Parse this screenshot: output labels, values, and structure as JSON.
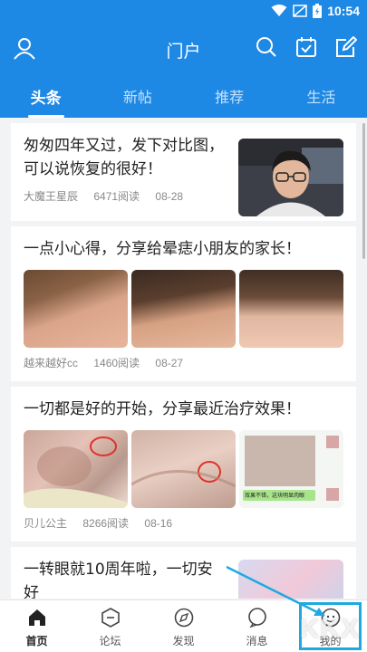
{
  "status": {
    "time": "10:54"
  },
  "appbar": {
    "title": "门户"
  },
  "tabs": [
    {
      "label": "头条",
      "active": true
    },
    {
      "label": "新帖",
      "active": false
    },
    {
      "label": "推荐",
      "active": false
    },
    {
      "label": "生活",
      "active": false
    }
  ],
  "posts": [
    {
      "title": "匆匆四年又过，发下对比图，可以说恢复的很好！",
      "author": "大魔王星辰",
      "views": "6471阅读",
      "date": "08-28"
    },
    {
      "title": "一点小心得，分享给晕痣小朋友的家长！",
      "author": "越来越好cc",
      "views": "1460阅读",
      "date": "08-27"
    },
    {
      "title": "一切都是好的开始，分享最近治疗效果！",
      "author": "贝儿公主",
      "views": "8266阅读",
      "date": "08-16",
      "chat_text": "效果不错，这块明显肉眼"
    },
    {
      "title": "一转眼就10周年啦，一切安好"
    }
  ],
  "nav": [
    {
      "label": "首页",
      "icon": "home-icon",
      "active": true
    },
    {
      "label": "论坛",
      "icon": "forum-icon",
      "active": false
    },
    {
      "label": "发现",
      "icon": "compass-icon",
      "active": false
    },
    {
      "label": "消息",
      "icon": "message-icon",
      "active": false
    },
    {
      "label": "我的",
      "icon": "profile-icon",
      "active": false
    }
  ],
  "colors": {
    "primary": "#1e88e5",
    "highlight": "#1ea9e1"
  },
  "watermark": "KKX"
}
